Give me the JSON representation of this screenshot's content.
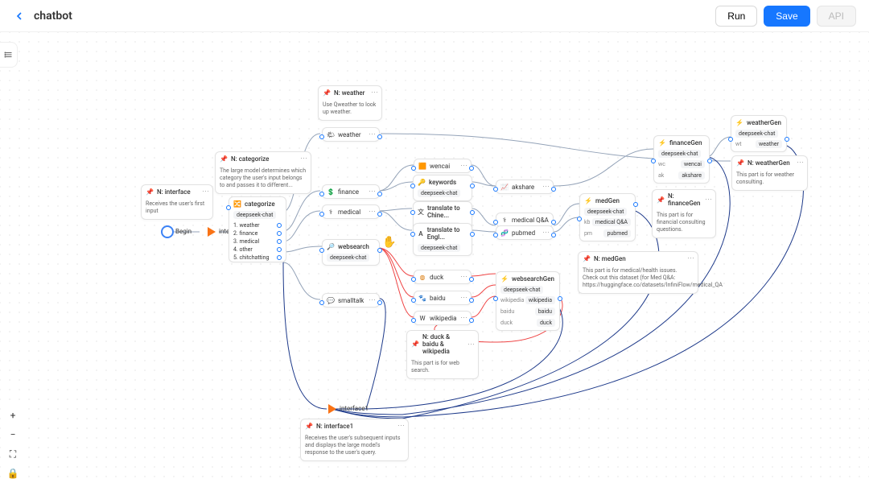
{
  "header": {
    "title": "chatbot",
    "run": "Run",
    "save": "Save",
    "api": "API"
  },
  "notes": {
    "weather": {
      "title": "N: weather",
      "body": "Use Qweather to look up weather."
    },
    "categorize": {
      "title": "N: categorize",
      "body": "The large model determines which category the user's input belongs to and passes it to different..."
    },
    "interface": {
      "title": "N: interface",
      "body": "Receives the user's first input"
    },
    "financeGen": {
      "title": "N: financeGen",
      "body": "This part is for financial consulting questions."
    },
    "weatherGen": {
      "title": "N: weatherGen",
      "body": "This part is for weather consulting."
    },
    "medGen": {
      "title": "N: medGen",
      "body": "This part is for medical/health issues. Check out this dataset (for Med Q&A: https://huggingface.co/datasets/InfiniFlow/medical_QA"
    },
    "websearch": {
      "title": "N: duck & baidu & wikipedia",
      "body": "This part is for web search."
    },
    "interface1": {
      "title": "N: interface1",
      "body": "Receives the user's subsequent inputs and displays the large model's response to the user's query."
    }
  },
  "nodes": {
    "begin": "Begin",
    "interface": "interface",
    "categorize": {
      "title": "categorize",
      "model": "deepseek-chat",
      "opts": [
        "1. weather",
        "2. finance",
        "3. medical",
        "4. other",
        "5. chitchatting"
      ]
    },
    "finance": "finance",
    "medical": "medical",
    "smalltalk": "smalltalk",
    "weather": "weather",
    "websearch": {
      "title": "websearch",
      "model": "deepseek-chat"
    },
    "wencai": "wencai",
    "keywords": {
      "title": "keywords",
      "model": "deepseek-chat"
    },
    "tChinese": {
      "title": "translate to Chine...",
      "model": "deepseek-chat"
    },
    "tEnglish": {
      "title": "translate to Engl...",
      "model": "deepseek-chat"
    },
    "akshare": "akshare",
    "medicalQA": "medical Q&A",
    "pubmed": "pubmed",
    "duck": "duck",
    "baidu": "baidu",
    "wikipedia": "wikipedia",
    "medGen": {
      "title": "medGen",
      "model": "deepseek-chat",
      "kb": "kb",
      "kbval": "medical Q&A",
      "pm": "pm",
      "pmval": "pubmed"
    },
    "financeGen": {
      "title": "financeGen",
      "model": "deepseek-chat",
      "wc": "wc",
      "wcval": "wencai",
      "ak": "ak",
      "akval": "akshare"
    },
    "weatherGen": {
      "title": "weatherGen",
      "model": "deepseek-chat",
      "wt": "wt",
      "wtval": "weather"
    },
    "websearchGen": {
      "title": "websearchGen",
      "model": "deepseek-chat",
      "wp": "wikipedia",
      "wpval": "wikipedia",
      "bd": "baidu",
      "bdval": "baidu",
      "dk": "duck",
      "dkval": "duck"
    },
    "interface1": "interface1"
  }
}
